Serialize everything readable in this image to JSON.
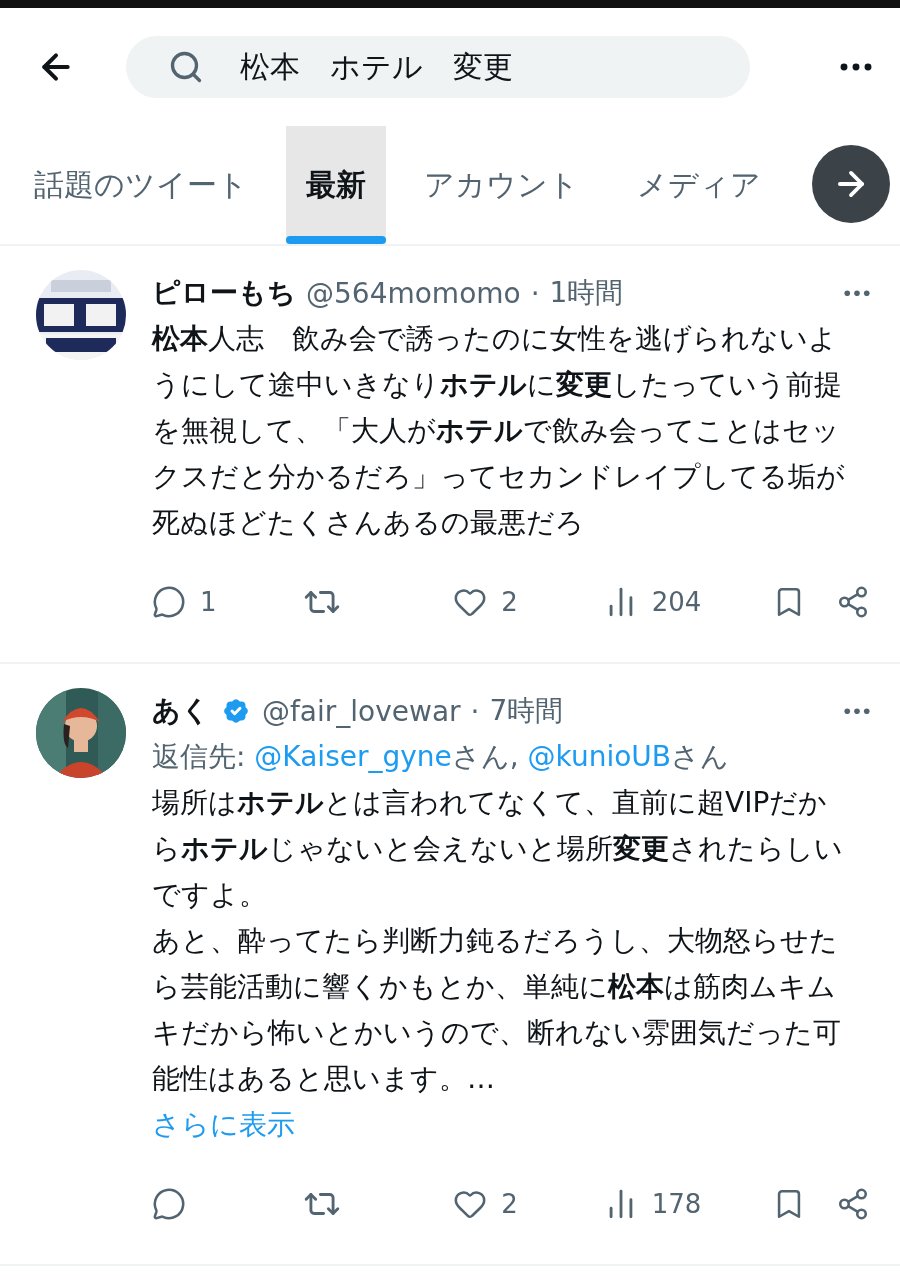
{
  "header": {
    "search": {
      "value": "松本　ホテル　変更"
    }
  },
  "tabs": [
    {
      "label": "話題のツイート",
      "selected": false
    },
    {
      "label": "最新",
      "selected": true
    },
    {
      "label": "アカウント",
      "selected": false
    },
    {
      "label": "メディア",
      "selected": false
    }
  ],
  "tweets": [
    {
      "name": "ピローもち",
      "verified": false,
      "handle": "@564momomo",
      "separator": "·",
      "time": "1時間",
      "paragraphs": [
        "**松本**人志　飲み会で誘ったのに女性を逃げられないようにして途中いきなり**ホテル**に**変更**したっていう前提を無視して、「大人が**ホテル**で飲み会ってことはセックスだと分かるだろ」ってセカンドレイプしてる垢が死ぬほどたくさんあるの最悪だろ"
      ],
      "actions": {
        "replies": "1",
        "likes": "2",
        "views": "204"
      }
    },
    {
      "name": "あく",
      "verified": true,
      "handle": "@fair_lovewar",
      "separator": "·",
      "time": "7時間",
      "reply_to": {
        "prefix": "返信先:",
        "mentions": [
          {
            "handle": "@Kaiser_gyne",
            "suffix": "さん,"
          },
          {
            "handle": "@kunioUB",
            "suffix": "さん"
          }
        ]
      },
      "paragraphs": [
        "場所は**ホテル**とは言われてなくて、直前に超VIPだから**ホテル**じゃないと会えないと場所**変更**されたらしいですよ。",
        "あと、酔ってたら判断力鈍るだろうし、大物怒らせたら芸能活動に響くかもとか、単純に**松本**は筋肉ムキムキだから怖いとかいうので、断れない雰囲気だった可能性はあると思います。…"
      ],
      "show_more": "さらに表示",
      "actions": {
        "likes": "2",
        "views": "178"
      }
    }
  ]
}
